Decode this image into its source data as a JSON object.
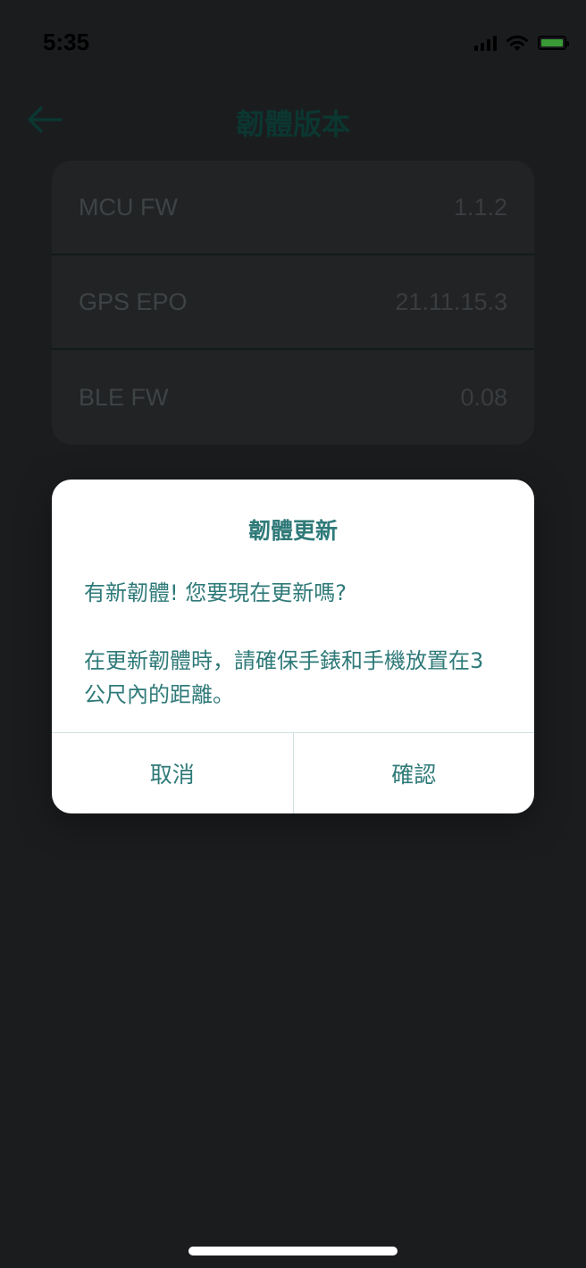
{
  "status_bar": {
    "time": "5:35",
    "icons": [
      "signal-icon",
      "wifi-icon",
      "battery-charging-icon"
    ]
  },
  "header": {
    "back_icon": "arrow-left-icon",
    "title": "韌體版本"
  },
  "versions": [
    {
      "label": "MCU FW",
      "value": "1.1.2"
    },
    {
      "label": "GPS EPO",
      "value": "21.11.15.3"
    },
    {
      "label": "BLE FW",
      "value": "0.08"
    }
  ],
  "dialog": {
    "title": "韌體更新",
    "message": "有新韌體! 您要現在更新嗎?\n\n在更新韌體時，請確保手錶和手機放置在3公尺內的距離。",
    "cancel_label": "取消",
    "confirm_label": "確認"
  },
  "colors": {
    "background": "#1b1c1e",
    "accent": "#2f7a79",
    "dialog_background": "#ffffff"
  }
}
